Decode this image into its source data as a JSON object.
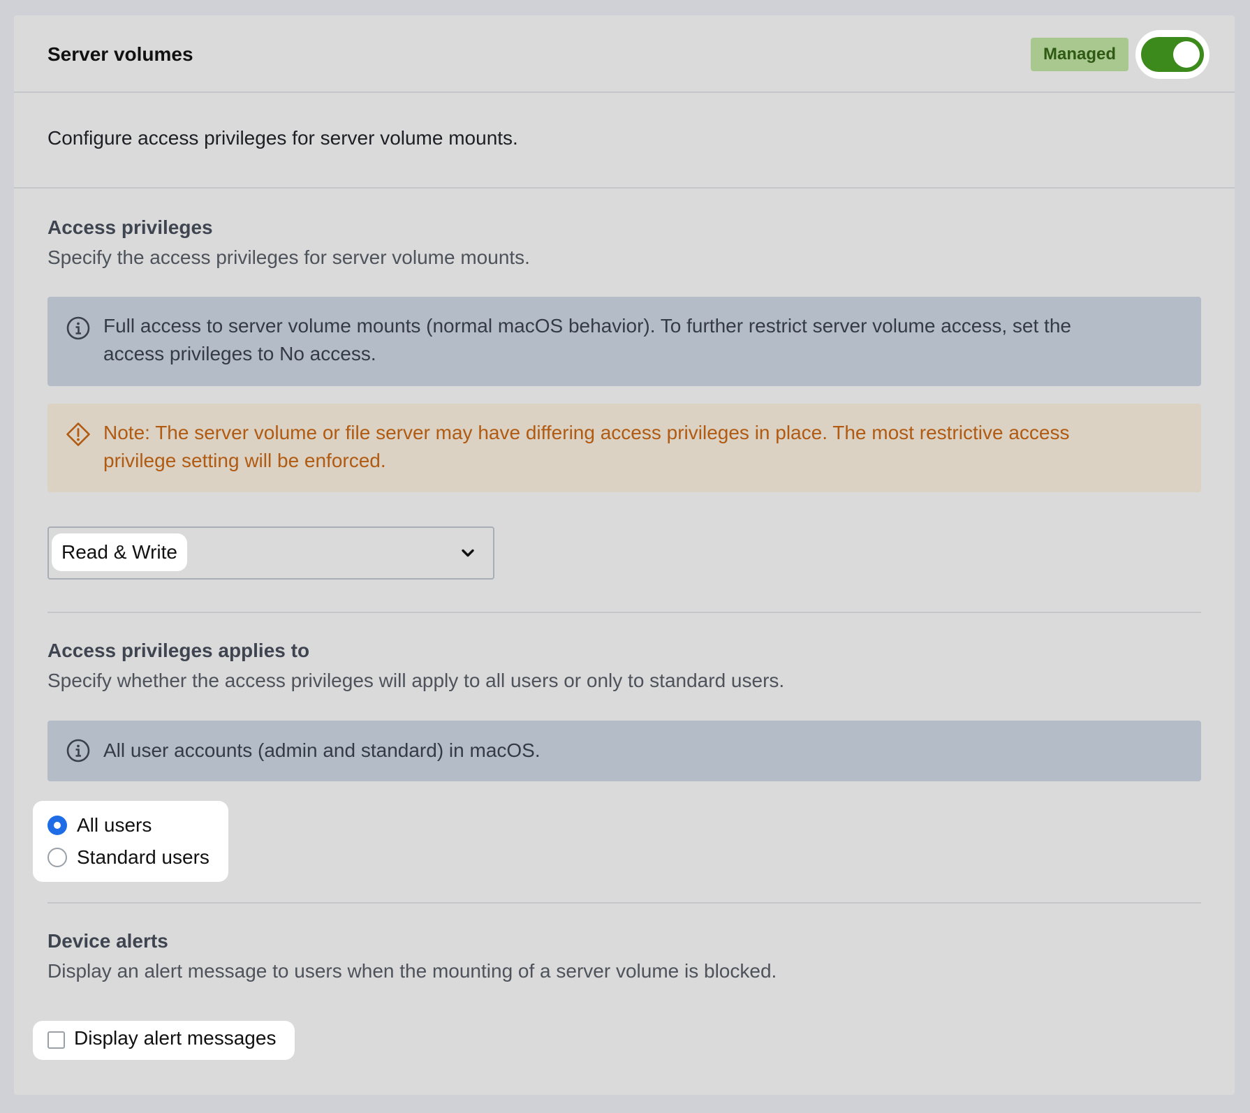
{
  "header": {
    "title": "Server volumes",
    "badge": "Managed",
    "toggle_on": true
  },
  "description": "Configure access privileges for server volume mounts.",
  "access_privileges": {
    "title": "Access privileges",
    "subtitle": "Specify the access privileges for server volume mounts.",
    "info": "Full access to server volume mounts (normal macOS behavior). To further restrict server volume access, set the access privileges to No access.",
    "warning": "Note: The server volume or file server may have differing access privileges in place. The most restrictive access privilege setting will be enforced.",
    "selected": "Read & Write"
  },
  "applies_to": {
    "title": "Access privileges applies to",
    "subtitle": "Specify whether the access privileges will apply to all users or only to standard users.",
    "info": "All user accounts (admin and standard) in macOS.",
    "options": [
      {
        "label": "All users",
        "checked": true
      },
      {
        "label": "Standard users",
        "checked": false
      }
    ]
  },
  "device_alerts": {
    "title": "Device alerts",
    "subtitle": "Display an alert message to users when the mounting of a server volume is blocked.",
    "checkbox_label": "Display alert messages",
    "checked": false
  },
  "colors": {
    "toggle_on": "#3d8a1c",
    "badge_bg": "#a9c890",
    "badge_text": "#2f5a13",
    "info_bg": "#b4bcc7",
    "warn_bg": "#dbd2c4",
    "warn_text": "#b05a12",
    "radio_checked": "#1e6de6"
  },
  "icons": {
    "info": "info-circle-icon",
    "warning": "warning-diamond-icon",
    "select": "chevron-down-icon"
  }
}
